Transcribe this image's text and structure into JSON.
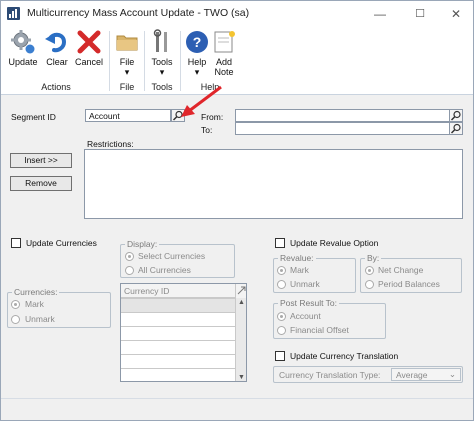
{
  "window": {
    "title": "Multicurrency Mass Account Update  -  TWO (sa)",
    "minimize_glyph": "—",
    "maximize_glyph": "☐",
    "close_glyph": "✕"
  },
  "ribbon": {
    "actions": {
      "group_label": "Actions",
      "update": "Update",
      "clear": "Clear",
      "cancel": "Cancel"
    },
    "file": {
      "group_label": "File",
      "file": "File"
    },
    "tools": {
      "group_label": "Tools",
      "tools": "Tools"
    },
    "help": {
      "group_label": "Help",
      "help": "Help",
      "add_note_line1": "Add",
      "add_note_line2": "Note"
    }
  },
  "segment": {
    "label": "Segment ID",
    "value": "Account",
    "from_label": "From:",
    "to_label": "To:",
    "from_value": "",
    "to_value": ""
  },
  "restrictions": {
    "label": "Restrictions:",
    "insert_button": "Insert >>",
    "remove_button": "Remove"
  },
  "update_currencies": {
    "label": "Update Currencies",
    "display_title": "Display:",
    "select_currencies": "Select Currencies",
    "all_currencies": "All Currencies",
    "currencies_title": "Currencies:",
    "mark": "Mark",
    "unmark": "Unmark",
    "grid_header": "Currency ID"
  },
  "revalue": {
    "label": "Update Revalue Option",
    "revalue_title": "Revalue:",
    "mark": "Mark",
    "unmark": "Unmark",
    "by_title": "By:",
    "net_change": "Net Change",
    "period_balances": "Period Balances",
    "post_title": "Post Result To:",
    "account": "Account",
    "financial_offset": "Financial Offset"
  },
  "translation": {
    "label": "Update Currency Translation",
    "type_label": "Currency Translation Type:",
    "type_value": "Average"
  },
  "colors": {
    "accent": "#2b5797",
    "arrow": "#e0262b"
  }
}
